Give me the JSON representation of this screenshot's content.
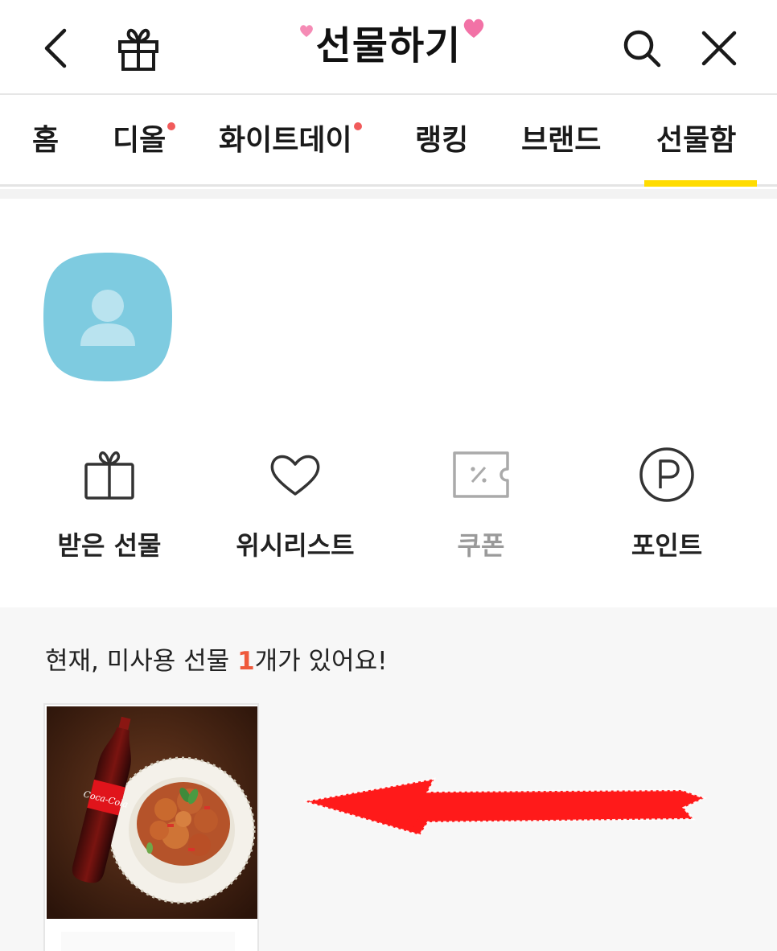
{
  "header": {
    "title": "선물하기",
    "icons": {
      "back": "chevron-left-icon",
      "gift": "gift-icon",
      "search": "search-icon",
      "close": "close-icon"
    }
  },
  "tabs": [
    {
      "label": "홈",
      "dot": false
    },
    {
      "label": "디올",
      "dot": true
    },
    {
      "label": "화이트데이",
      "dot": true
    },
    {
      "label": "랭킹",
      "dot": false
    },
    {
      "label": "브랜드",
      "dot": false
    },
    {
      "label": "선물함",
      "dot": false,
      "selected": true
    }
  ],
  "profile": {
    "avatar_icon": "user-avatar-icon",
    "avatar_color": "#7ecbe0"
  },
  "quick_menu": [
    {
      "label": "받은 선물",
      "icon": "gift-icon"
    },
    {
      "label": "위시리스트",
      "icon": "heart-icon"
    },
    {
      "label": "쿠폰",
      "icon": "coupon-icon"
    },
    {
      "label": "포인트",
      "icon": "point-icon"
    }
  ],
  "unused": {
    "prefix": "현재, 미사용 선물 ",
    "count": "1",
    "suffix": "개가 있어요!"
  },
  "gift_card": {
    "image": "food-with-cola-image",
    "cola_label": "Coca-Cola"
  },
  "colors": {
    "accent_yellow": "#ffdc00",
    "badge_red": "#f15b5b",
    "count_red": "#ef5a3c",
    "arrow_red": "#ff1a1a"
  }
}
